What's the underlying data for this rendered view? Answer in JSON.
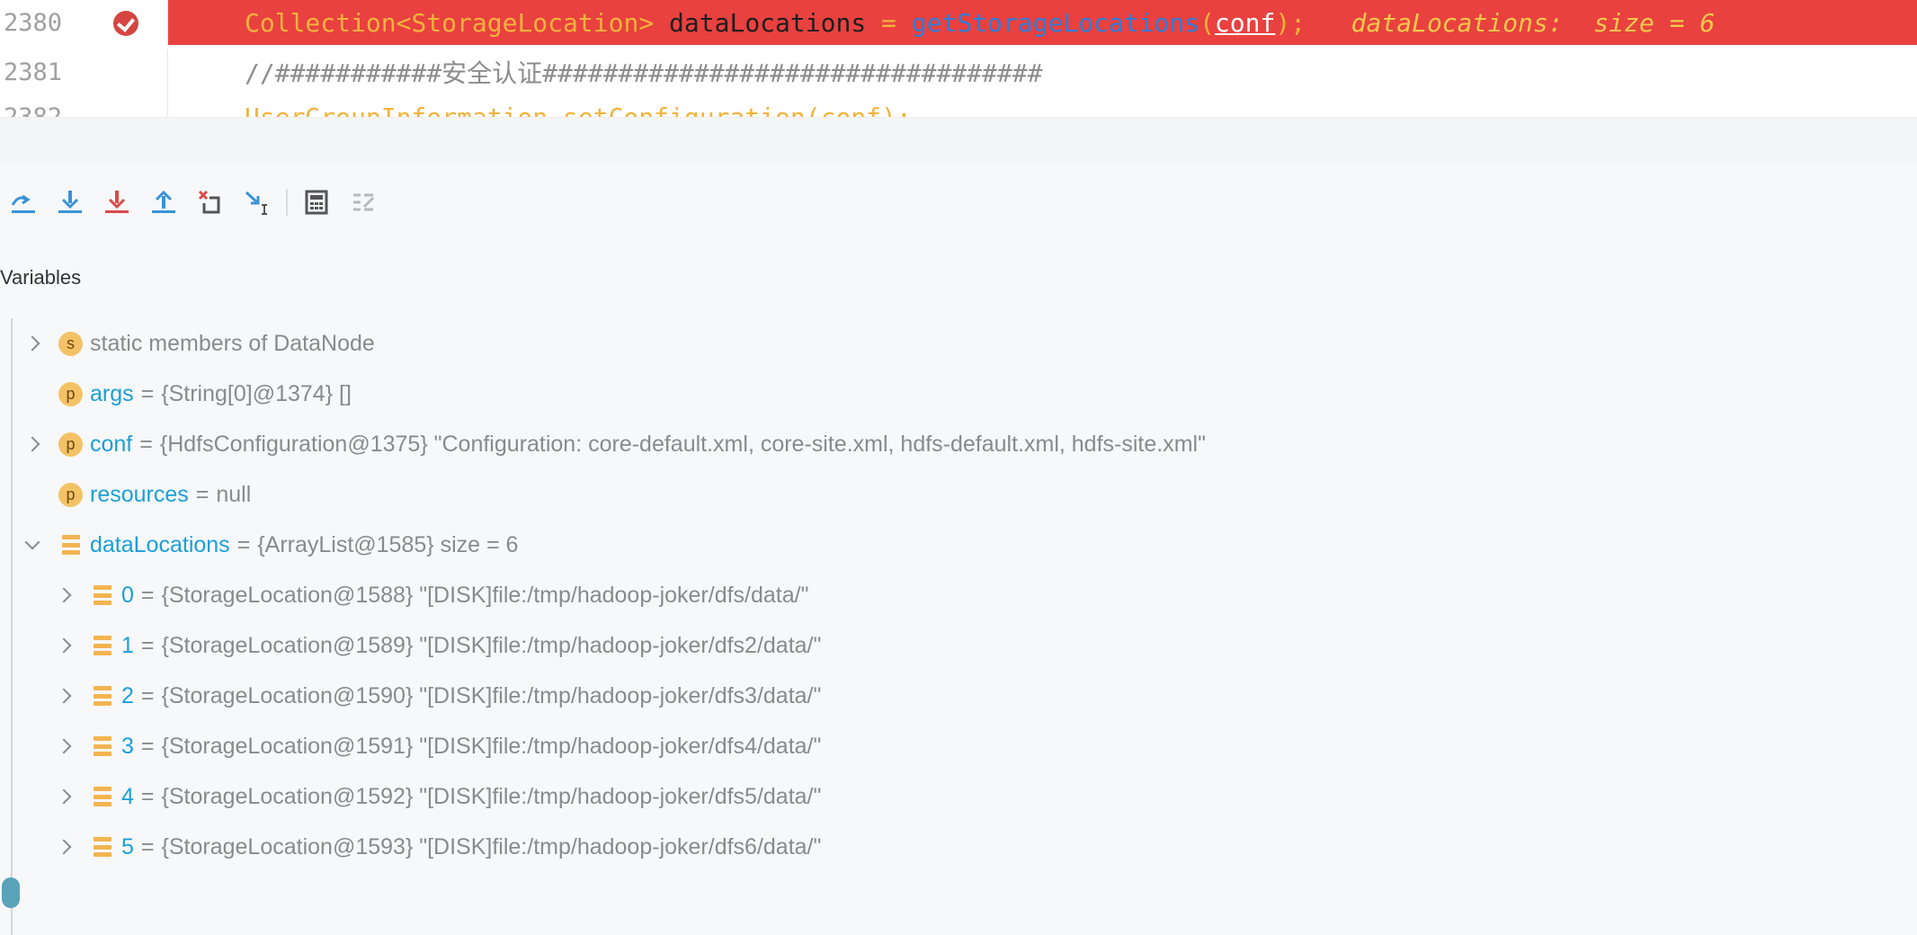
{
  "editor": {
    "lines": [
      {
        "number": "2380",
        "breakpoint": true,
        "tokens": {
          "type": "Collection",
          "lt": "<",
          "generic": "StorageLocation",
          "gt": ">",
          "var": " dataLocations ",
          "assign": "=",
          "fn": " getStorageLocations",
          "open": "(",
          "param": "conf",
          "close": ");",
          "hint": "   dataLocations:  size = 6"
        }
      },
      {
        "number": "2381",
        "breakpoint": false,
        "comment": "//###########安全认证#################################"
      },
      {
        "number": "2382",
        "breakpoint": false,
        "partial": "UserGroupInformation.setConfiguration(conf);"
      }
    ]
  },
  "toolbar": {
    "buttons": [
      {
        "name": "step-over-icon"
      },
      {
        "name": "step-into-icon"
      },
      {
        "name": "force-step-into-icon"
      },
      {
        "name": "step-out-icon"
      },
      {
        "name": "drop-frame-icon"
      },
      {
        "name": "run-to-cursor-icon"
      },
      {
        "name": "evaluate-expression-icon"
      },
      {
        "name": "trace-stream-icon"
      }
    ]
  },
  "variables": {
    "header": "Variables",
    "items": [
      {
        "kind": "static",
        "badge": "s",
        "text": "static members of DataNode",
        "expandable": true
      },
      {
        "kind": "param",
        "badge": "p",
        "name": "args",
        "eq": "=",
        "value": "{String[0]@1374} []",
        "expandable": false
      },
      {
        "kind": "param",
        "badge": "p",
        "name": "conf",
        "eq": "=",
        "value": "{HdfsConfiguration@1375} \"Configuration: core-default.xml, core-site.xml, hdfs-default.xml, hdfs-site.xml\"",
        "expandable": true
      },
      {
        "kind": "param",
        "badge": "p",
        "name": "resources",
        "eq": "=",
        "value": "null",
        "expandable": false
      },
      {
        "kind": "list",
        "name": "dataLocations",
        "eq": "=",
        "value": "{ArrayList@1585}  size = 6",
        "expanded": true
      },
      {
        "kind": "child",
        "name": "0",
        "eq": "=",
        "value": "{StorageLocation@1588} \"[DISK]file:/tmp/hadoop-joker/dfs/data/\""
      },
      {
        "kind": "child",
        "name": "1",
        "eq": "=",
        "value": "{StorageLocation@1589} \"[DISK]file:/tmp/hadoop-joker/dfs2/data/\""
      },
      {
        "kind": "child",
        "name": "2",
        "eq": "=",
        "value": "{StorageLocation@1590} \"[DISK]file:/tmp/hadoop-joker/dfs3/data/\""
      },
      {
        "kind": "child",
        "name": "3",
        "eq": "=",
        "value": "{StorageLocation@1591} \"[DISK]file:/tmp/hadoop-joker/dfs4/data/\""
      },
      {
        "kind": "child",
        "name": "4",
        "eq": "=",
        "value": "{StorageLocation@1592} \"[DISK]file:/tmp/hadoop-joker/dfs5/data/\""
      },
      {
        "kind": "child",
        "name": "5",
        "eq": "=",
        "value": "{StorageLocation@1593} \"[DISK]file:/tmp/hadoop-joker/dfs6/data/\""
      }
    ]
  },
  "colors": {
    "breakpoint_line": "#e9413f",
    "var_name": "#1a9fd9",
    "badge": "#f4c266"
  }
}
